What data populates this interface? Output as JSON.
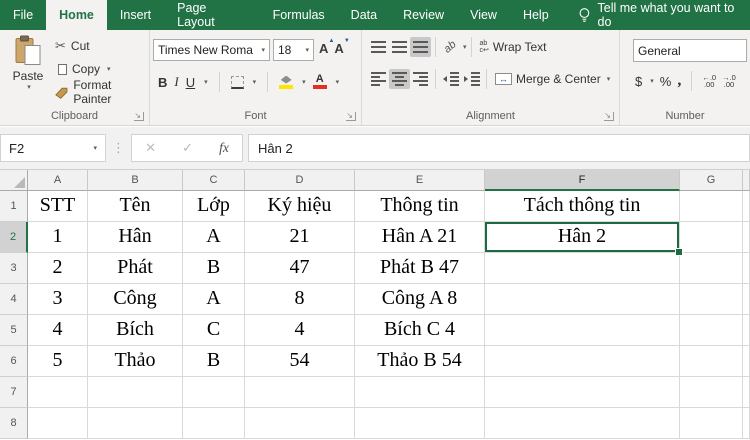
{
  "colors": {
    "accent_green": "#217346",
    "fill_yellow": "#ffe400",
    "font_red": "#e0321e"
  },
  "ribbon": {
    "tabs": [
      {
        "label": "File"
      },
      {
        "label": "Home"
      },
      {
        "label": "Insert"
      },
      {
        "label": "Page Layout"
      },
      {
        "label": "Formulas"
      },
      {
        "label": "Data"
      },
      {
        "label": "Review"
      },
      {
        "label": "View"
      },
      {
        "label": "Help"
      }
    ],
    "tell_me": "Tell me what you want to do",
    "clipboard": {
      "label": "Clipboard",
      "paste": "Paste",
      "cut": "Cut",
      "copy": "Copy",
      "format_painter": "Format Painter"
    },
    "font": {
      "label": "Font",
      "name": "Times New Roma",
      "size": "18",
      "bold": "B",
      "italic": "I",
      "underline": "U",
      "grow": "A",
      "shrink": "A",
      "color_a": "A"
    },
    "alignment": {
      "label": "Alignment",
      "wrap_text": "Wrap Text",
      "merge_center": "Merge & Center",
      "orientation": "ab"
    },
    "number": {
      "label": "Number",
      "format": "General",
      "currency": "$",
      "percent": "%",
      "comma": ","
    }
  },
  "glyphs": {
    "dropdown": "▾",
    "launcher": "↘",
    "dots": "⋮",
    "cut": "✂",
    "cancel": "✕",
    "enter": "✓",
    "fx": "fx",
    "tri_up": "▲",
    "tri_down": "▼",
    "merge_arrows": "↔",
    "wrap_lines": "ab\nc↩",
    "dec_increase": "←.0\n.00",
    "dec_decrease": "→.0\n.00"
  },
  "formula_bar": {
    "name_box": "F2",
    "value": "Hân 2"
  },
  "sheet": {
    "columns": [
      "A",
      "B",
      "C",
      "D",
      "E",
      "F",
      "G"
    ],
    "selected_cell": "F2",
    "rows": [
      {
        "n": "1",
        "cells": [
          "STT",
          "Tên",
          "Lớp",
          "Ký hiệu",
          "Thông tin",
          "Tách thông tin",
          ""
        ]
      },
      {
        "n": "2",
        "cells": [
          "1",
          "Hân",
          "A",
          "21",
          "Hân A 21",
          "Hân 2",
          ""
        ]
      },
      {
        "n": "3",
        "cells": [
          "2",
          "Phát",
          "B",
          "47",
          "Phát B 47",
          "",
          ""
        ]
      },
      {
        "n": "4",
        "cells": [
          "3",
          "Công",
          "A",
          "8",
          "Công A 8",
          "",
          ""
        ]
      },
      {
        "n": "5",
        "cells": [
          "4",
          "Bích",
          "C",
          "4",
          "Bích C 4",
          "",
          ""
        ]
      },
      {
        "n": "6",
        "cells": [
          "5",
          "Thảo",
          "B",
          "54",
          "Thảo B 54",
          "",
          ""
        ]
      },
      {
        "n": "7",
        "cells": [
          "",
          "",
          "",
          "",
          "",
          "",
          ""
        ]
      },
      {
        "n": "8",
        "cells": [
          "",
          "",
          "",
          "",
          "",
          "",
          ""
        ]
      }
    ]
  }
}
